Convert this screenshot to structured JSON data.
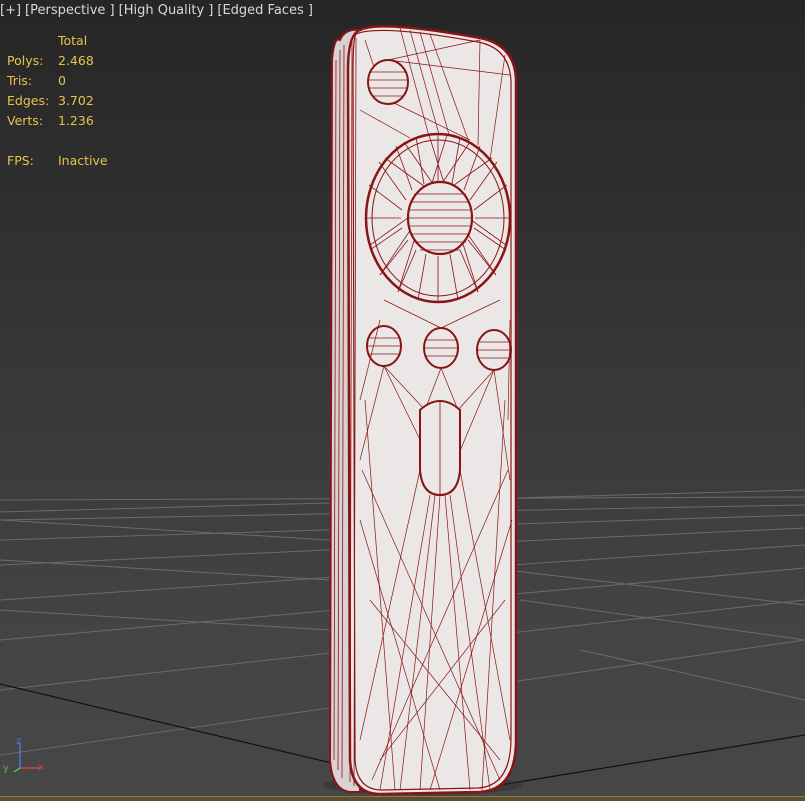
{
  "viewport_label": {
    "plus": "[+]",
    "view": "[Perspective ]",
    "shading": "[High Quality ]",
    "edges": "[Edged Faces ]"
  },
  "stats": {
    "header": "Total",
    "rows": [
      {
        "label": "Polys:",
        "value": "2.468"
      },
      {
        "label": "Tris:",
        "value": "0"
      },
      {
        "label": "Edges:",
        "value": "3.702"
      },
      {
        "label": "Verts:",
        "value": "1.236"
      }
    ],
    "fps_label": "FPS:",
    "fps_value": "Inactive"
  },
  "axis_gizmo": {
    "x_label": "x",
    "y_label": "y",
    "z_label": "z"
  },
  "colors": {
    "wire": "#8a1414",
    "object_face": "#ebe7e7",
    "stats_text": "#e6c44b",
    "grid": "#6a6a6a",
    "axis_x": "#d64545",
    "axis_y": "#4bbf4b",
    "axis_z": "#4a78e0"
  }
}
